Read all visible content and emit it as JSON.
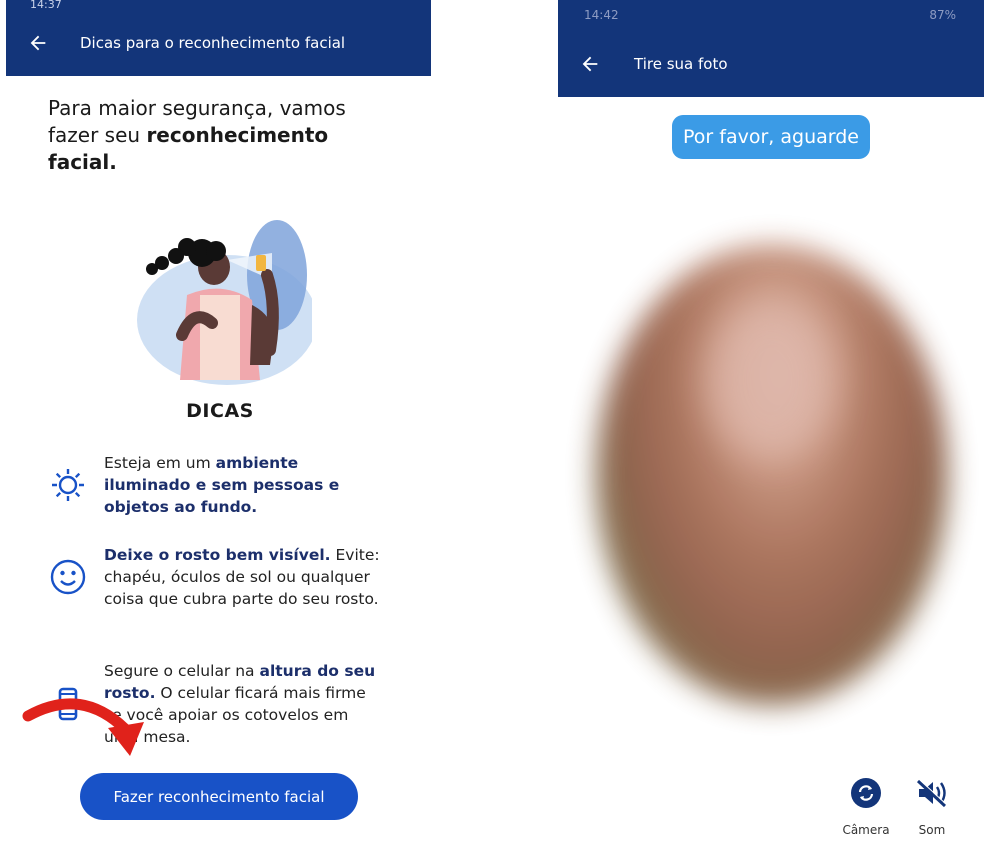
{
  "left_screen": {
    "status_text": "14:37",
    "appbar": {
      "title": "Dicas para o reconhecimento facial",
      "back_icon": "arrow-left-icon"
    },
    "intro": {
      "line_start": "Para maior segurança, vamos fazer seu ",
      "bold": "reconhecimento facial."
    },
    "illustration_icon": "woman-taking-selfie-illustration",
    "tips_title": "DICAS",
    "tips": [
      {
        "icon": "sun-icon",
        "text_start": "Esteja em um ",
        "bold": "ambiente iluminado e sem pessoas e objetos ao fundo.",
        "text_end": ""
      },
      {
        "icon": "smile-icon",
        "text_start": "",
        "bold": "Deixe o rosto bem visível.",
        "text_end": " Evite: chapéu, óculos de sol ou qualquer coisa que cubra parte do seu rosto."
      },
      {
        "icon": "phone-icon",
        "text_start": "Segure o celular na ",
        "bold": "altura do seu rosto.",
        "text_end": " O celular ficará mais firme se você apoiar os cotovelos em uma mesa."
      }
    ],
    "primary_button": "Fazer reconhecimento facial",
    "annotation_icon": "red-curved-arrow-icon"
  },
  "right_screen": {
    "status_text": "14:42",
    "status_right": "87%",
    "appbar": {
      "title": "Tire sua foto",
      "back_icon": "arrow-left-icon"
    },
    "wait_message": "Por favor, aguarde",
    "camera_button": {
      "icon": "camera-switch-icon",
      "label": "Câmera"
    },
    "sound_button": {
      "icon": "sound-off-icon",
      "label": "Som"
    }
  },
  "colors": {
    "appbar": "#13357a",
    "primary": "#1852c7",
    "pill": "#3b9be6",
    "accent_text": "#1c2f6b",
    "arrow": "#e0221b"
  }
}
